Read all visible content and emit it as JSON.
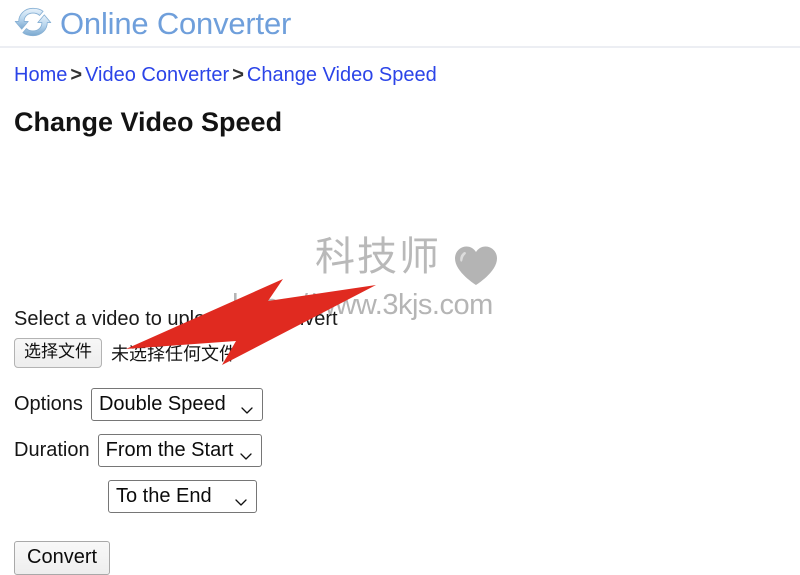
{
  "header": {
    "logo_icon": "refresh-arrows-icon",
    "brand": "Online Converter"
  },
  "breadcrumb": {
    "items": [
      {
        "label": "Home"
      },
      {
        "label": "Video Converter"
      },
      {
        "label": "Change Video Speed"
      }
    ],
    "separator": ">"
  },
  "main": {
    "title": "Change Video Speed",
    "instruction": "Select a video to upload and convert",
    "file_input": {
      "button_label": "选择文件",
      "status_text": "未选择任何文件"
    },
    "options": {
      "label": "Options",
      "value": "Double Speed"
    },
    "duration": {
      "label": "Duration",
      "from_value": "From the Start",
      "to_value": "To the End"
    },
    "convert_label": "Convert"
  },
  "watermark": {
    "cjk_text": "科技师",
    "heart_icon": "heart-icon",
    "url_text": "https://www.3kjs.com"
  },
  "annotation": {
    "arrow_icon": "red-arrow-pointing-left-down",
    "color": "#e02a20"
  },
  "colors": {
    "brand_blue": "#6f9fdb",
    "link_blue": "#2b44e8",
    "title_black": "#131313",
    "watermark_gray": "#b9b9b9",
    "arrow_red": "#e02a20"
  }
}
